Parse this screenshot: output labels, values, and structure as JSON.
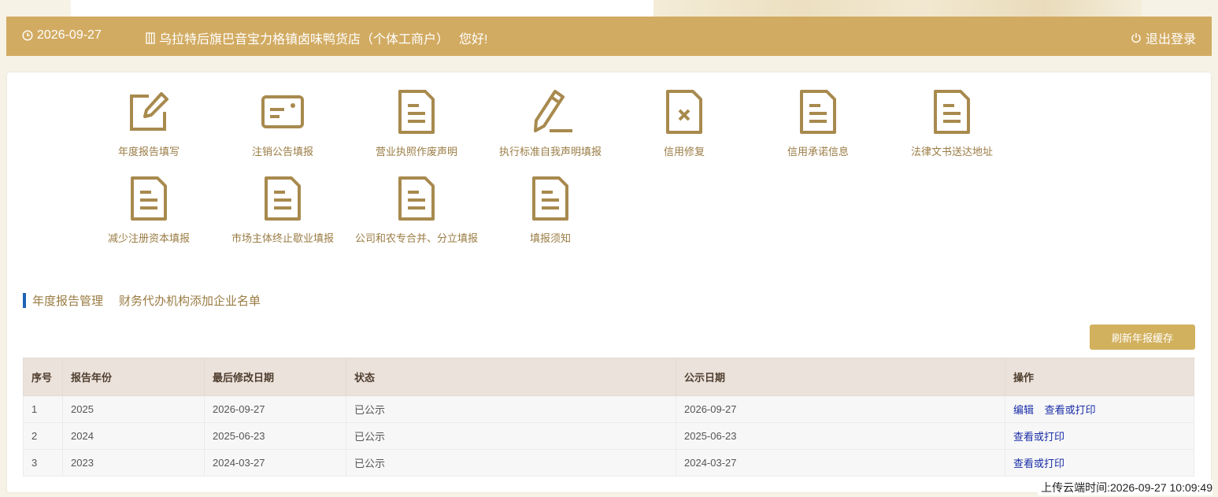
{
  "header": {
    "date": "2026-09-27",
    "company": "乌拉特后旗巴音宝力格镇卤味鸭货店（个体工商户）",
    "greeting": "您好!",
    "logout": "退出登录"
  },
  "functions": [
    {
      "label": "年度报告填写",
      "icon": "edit-icon"
    },
    {
      "label": "注销公告填报",
      "icon": "card-icon"
    },
    {
      "label": "营业执照作废声明",
      "icon": "document-icon"
    },
    {
      "label": "执行标准自我声明填报",
      "icon": "pencil-icon"
    },
    {
      "label": "信用修复",
      "icon": "document-x-icon"
    },
    {
      "label": "信用承诺信息",
      "icon": "document-icon"
    },
    {
      "label": "法律文书送达地址",
      "icon": "document-icon"
    },
    {
      "label": "减少注册资本填报",
      "icon": "document-icon"
    },
    {
      "label": "市场主体终止歇业填报",
      "icon": "document-icon"
    },
    {
      "label": "公司和农专合并、分立填报",
      "icon": "document-icon"
    },
    {
      "label": "填报须知",
      "icon": "document-icon"
    }
  ],
  "section": {
    "tab1": "年度报告管理",
    "tab2": "财务代办机构添加企业名单"
  },
  "refresh_button": "刷新年报缓存",
  "table": {
    "headers": [
      "序号",
      "报告年份",
      "最后修改日期",
      "状态",
      "公示日期",
      "操作"
    ],
    "rows": [
      {
        "no": "1",
        "year": "2025",
        "modified": "2026-09-27",
        "status": "已公示",
        "published": "2026-09-27",
        "action1": "编辑",
        "action2": "查看或打印"
      },
      {
        "no": "2",
        "year": "2024",
        "modified": "2025-06-23",
        "status": "已公示",
        "published": "2025-06-23",
        "action1": "查看或打印",
        "action2": ""
      },
      {
        "no": "3",
        "year": "2023",
        "modified": "2024-03-27",
        "status": "已公示",
        "published": "2024-03-27",
        "action1": "查看或打印",
        "action2": ""
      }
    ]
  },
  "upload_time": "上传云端时间:2026-09-27 10:09:49",
  "colors": {
    "header_bg": "#d2ab62",
    "icon_color": "#a88a4e",
    "label_color": "#9a7c44",
    "accent_blue": "#1e63b5",
    "button_bg": "#d2b15e",
    "link_color": "#1a2ea8"
  }
}
